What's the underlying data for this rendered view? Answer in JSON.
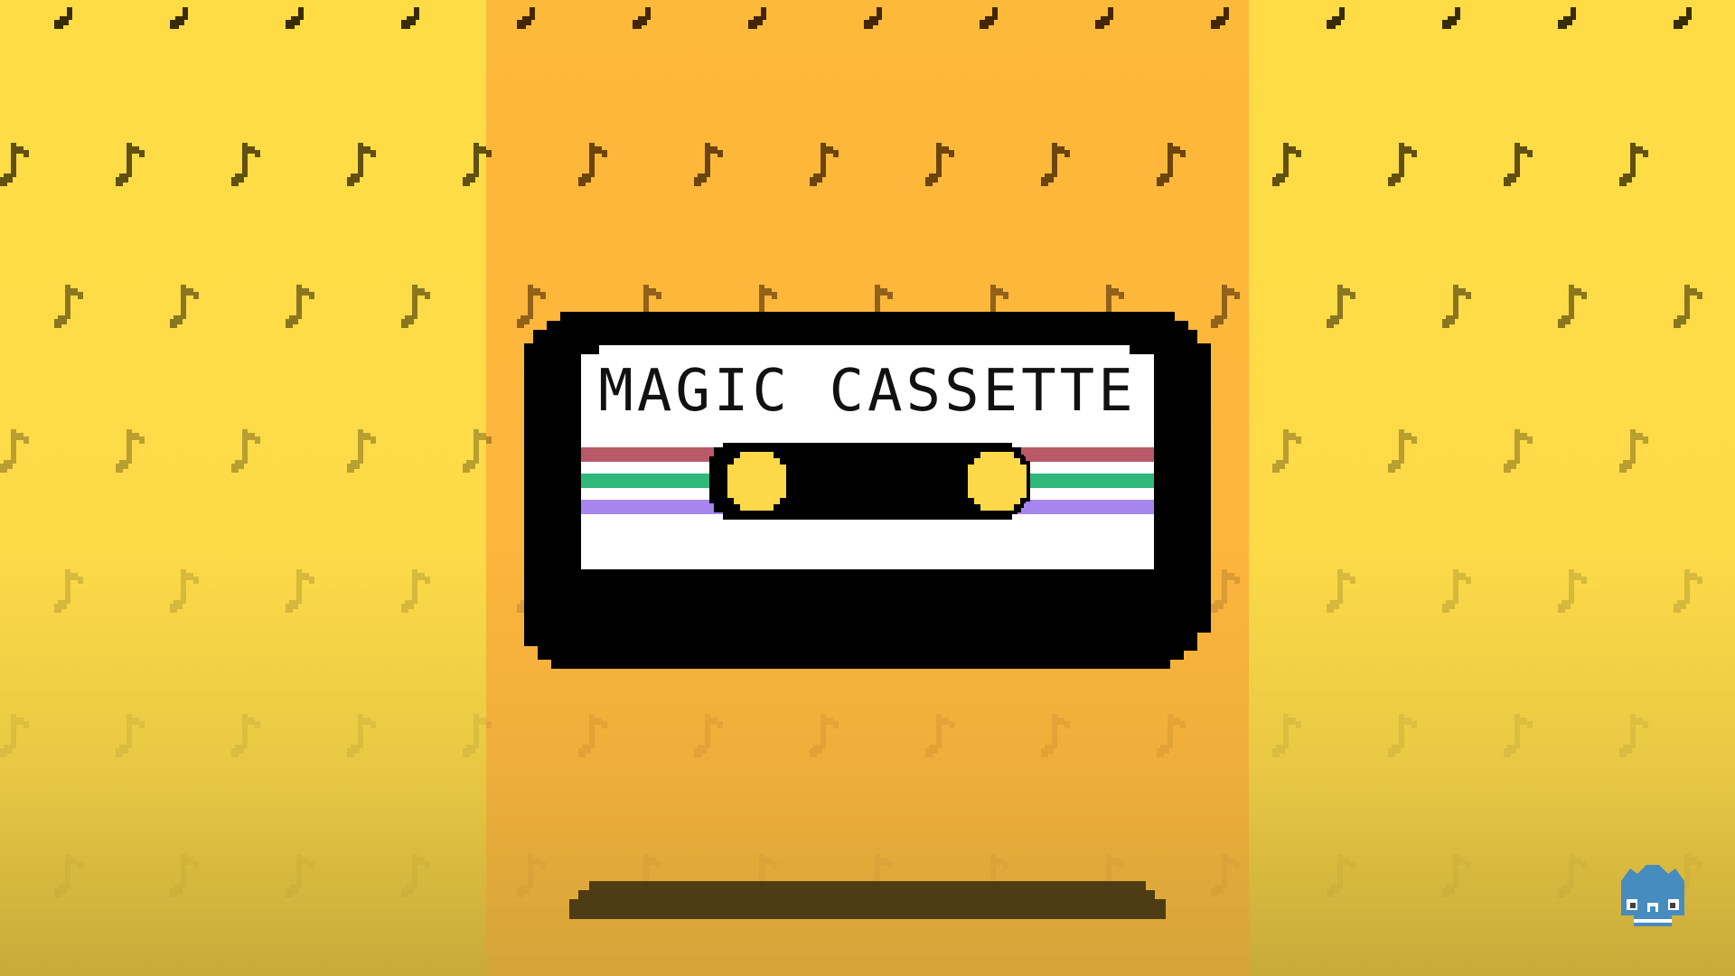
{
  "game": {
    "title": "MAGIC CASSETTE"
  },
  "colors": {
    "bg_side": "#ffdc45",
    "bg_center": "#fdb93a",
    "cassette_body": "#000000",
    "label": "#ffffff",
    "stripe_red": "#b85a68",
    "stripe_green": "#2fb87a",
    "stripe_purple": "#a685ee",
    "reel": "#fdd94a",
    "shadow": "#4e3d14",
    "logo_blue": "#478cbf"
  },
  "icons": {
    "background_pattern": "music-note-icon",
    "engine_logo": "godot-logo-icon"
  }
}
